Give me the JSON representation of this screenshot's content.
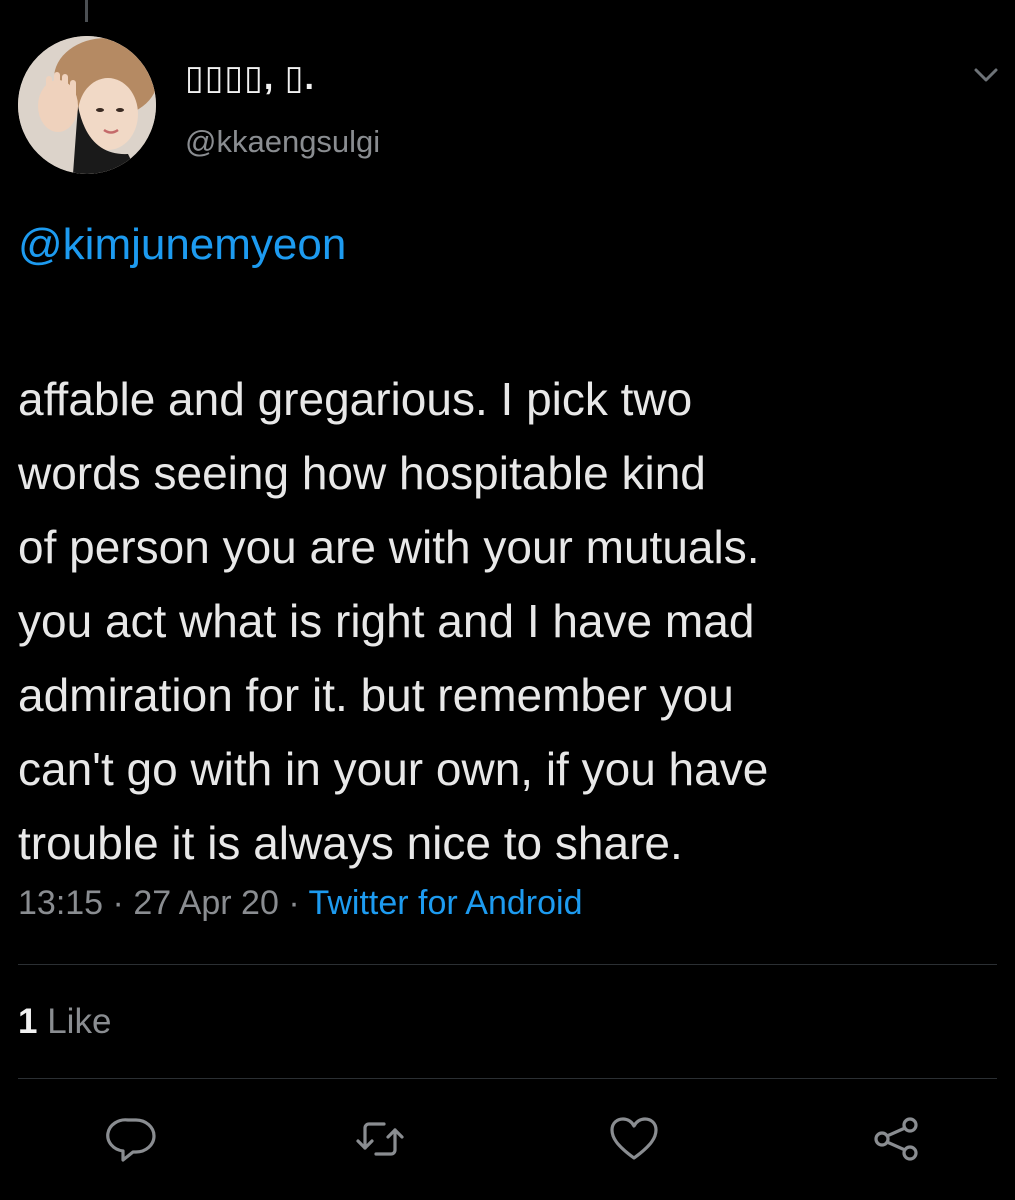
{
  "author": {
    "display_name": "▯▯▯▯, ▯.",
    "handle": "@kkaengsulgi"
  },
  "tweet": {
    "mention": "@kimjunemyeon",
    "text": "affable and gregarious. I pick two\nwords seeing how hospitable kind\nof person you are with your mutuals.\nyou act what is right and I have mad\nadmiration for it. but remember you\ncan't go with in your own, if you have\ntrouble it is always nice to share.",
    "time": "13:15",
    "separator": " · ",
    "date": "27 Apr 20",
    "source": "Twitter for Android"
  },
  "stats": {
    "like_count": "1",
    "like_label": "Like"
  },
  "icons": {
    "menu": "chevron-down-icon",
    "reply": "reply-icon",
    "retweet": "retweet-icon",
    "like": "heart-icon",
    "share": "share-icon"
  },
  "colors": {
    "background": "#000000",
    "link": "#1d9bf0",
    "muted": "#8a8d91",
    "divider": "#2b2f33"
  }
}
